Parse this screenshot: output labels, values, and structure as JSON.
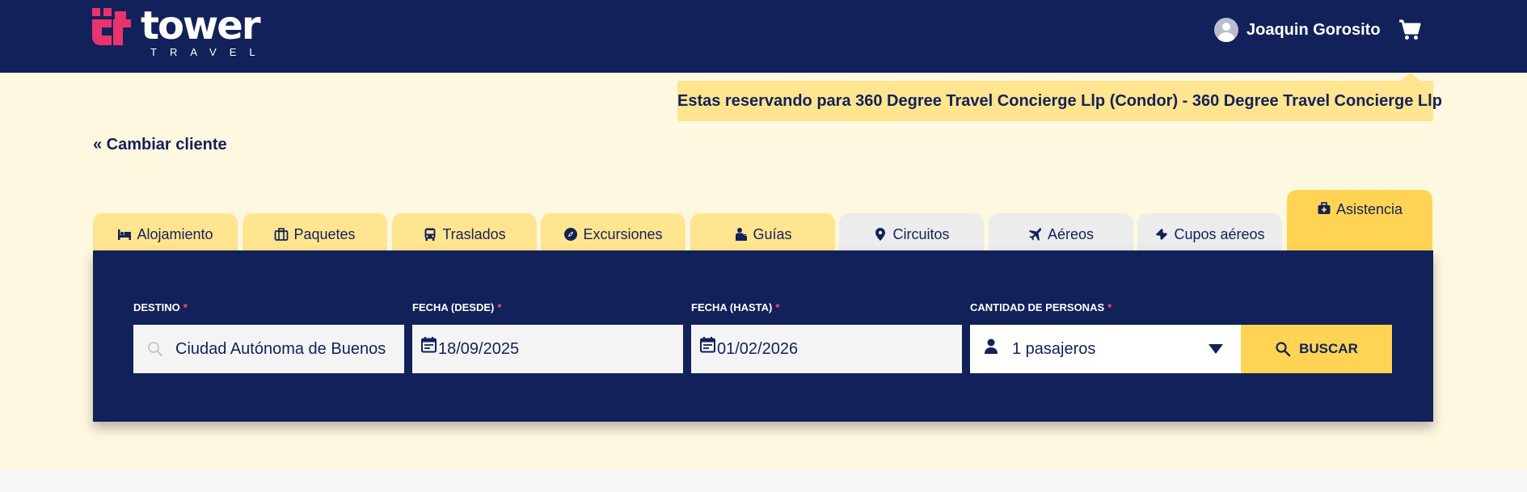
{
  "header": {
    "logo_word": "tower",
    "logo_sub": "TRAVEL",
    "user_name": "Joaquin Gorosito",
    "brand_color": "#e8336e",
    "navy": "#13215a"
  },
  "notice": {
    "text": "Estas reservando para 360 Degree Travel Concierge Llp (Condor) - 360 Degree Travel Concierge Llp"
  },
  "change_client": "« Cambiar cliente",
  "tabs": [
    {
      "label": "Alojamiento",
      "icon": "bed-icon"
    },
    {
      "label": "Paquetes",
      "icon": "suitcase-icon"
    },
    {
      "label": "Traslados",
      "icon": "bus-icon"
    },
    {
      "label": "Excursiones",
      "icon": "compass-icon"
    },
    {
      "label": "Guías",
      "icon": "guide-icon"
    },
    {
      "label": "Circuitos",
      "icon": "map-pin-icon"
    },
    {
      "label": "Aéreos",
      "icon": "plane-icon"
    },
    {
      "label": "Cupos aéreos",
      "icon": "ticket-icon"
    },
    {
      "label": "Asistencia",
      "icon": "medical-kit-icon"
    }
  ],
  "form": {
    "destino_label": "DESTINO",
    "destino_value": "Ciudad Autónoma de Buenos",
    "desde_label": "FECHA (DESDE)",
    "desde_value": "18/09/2025",
    "hasta_label": "FECHA (HASTA)",
    "hasta_value": "01/02/2026",
    "personas_label": "CANTIDAD DE PERSONAS",
    "personas_value": "1 pasajeros",
    "required_mark": "*",
    "search_label": "BUSCAR"
  }
}
